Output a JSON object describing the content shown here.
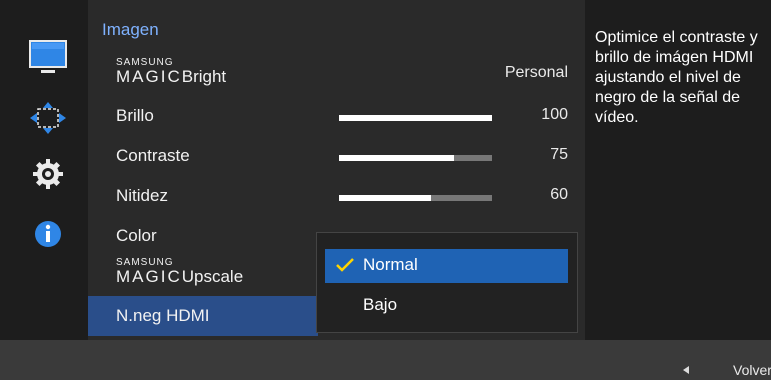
{
  "sidebar": {
    "icons": [
      "picture-icon",
      "screen-adjust-icon",
      "gear-icon",
      "info-icon"
    ]
  },
  "menu": {
    "title": "Imagen",
    "rows": [
      {
        "label_small": "SAMSUNG",
        "label_big": "MAGIC",
        "label_rest": "Bright",
        "value": "Personal"
      },
      {
        "label": "Brillo",
        "value": "100",
        "level": 100
      },
      {
        "label": "Contraste",
        "value": "75",
        "level": 75
      },
      {
        "label": "Nitidez",
        "value": "60",
        "level": 60
      },
      {
        "label": "Color"
      },
      {
        "label_small": "SAMSUNG",
        "label_big": "MAGIC",
        "label_rest": "Upscale"
      },
      {
        "label": "N.neg HDMI"
      }
    ]
  },
  "dropdown": {
    "options": [
      "Normal",
      "Bajo"
    ],
    "selected": "Normal"
  },
  "info": {
    "text": "Optimice el contraste y brillo de imágen HDMI ajustando el nivel de negro de la señal de vídeo."
  },
  "footer": {
    "back_label": "Volver"
  },
  "colors": {
    "title": "#7fb2ff",
    "selected_row": "#2a4e8a",
    "dropdown_active": "#1f63b4",
    "check": "#ffd400"
  }
}
